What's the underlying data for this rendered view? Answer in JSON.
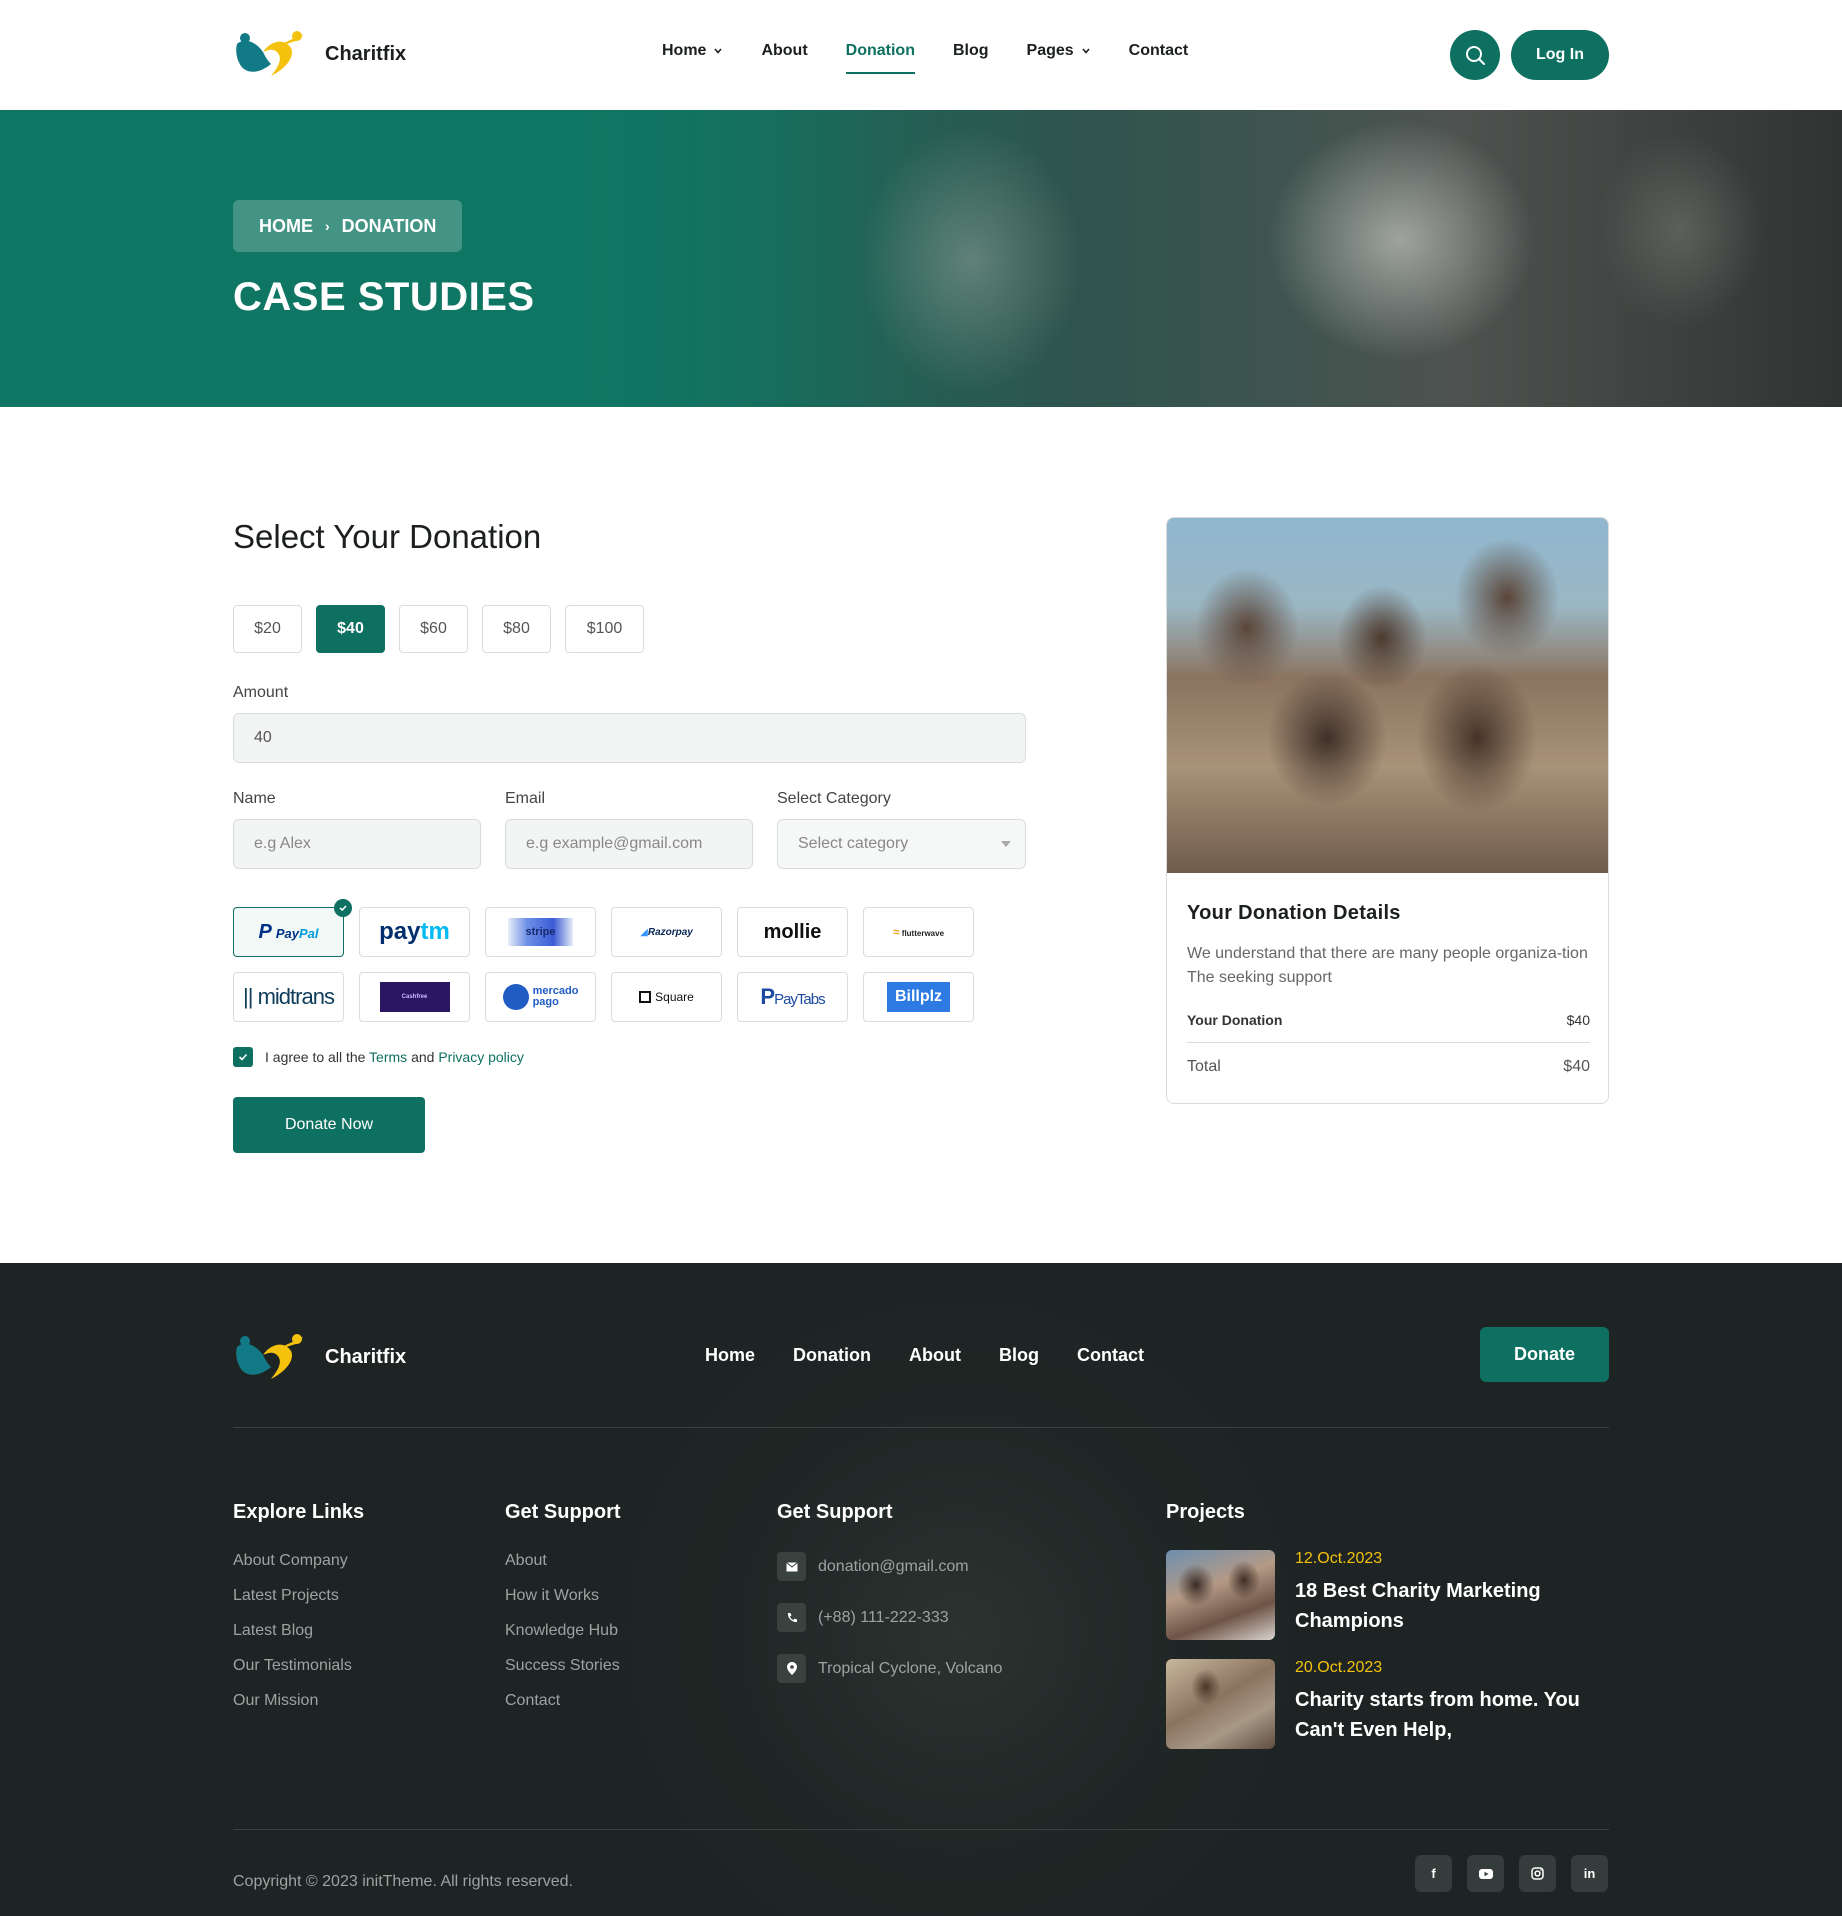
{
  "header": {
    "brand": "Charitfix",
    "nav": [
      {
        "label": "Home"
      },
      {
        "label": "About"
      },
      {
        "label": "Donation"
      },
      {
        "label": "Blog"
      },
      {
        "label": "Pages"
      },
      {
        "label": "Contact"
      }
    ],
    "login_label": "Log In",
    "search_icon": "search-icon"
  },
  "hero": {
    "breadcrumb": [
      "HOME",
      "DONATION"
    ],
    "title": "CASE STUDIES"
  },
  "donation": {
    "title": "Select Your Donation",
    "amounts": [
      "$20",
      "$40",
      "$60",
      "$80",
      "$100"
    ],
    "selected_amount": "$40",
    "amount_label": "Amount",
    "amount_value": "40",
    "name_label": "Name",
    "name_placeholder": "e.g Alex",
    "email_label": "Email",
    "email_placeholder": "e.g example@gmail.com",
    "category_label": "Select Category",
    "category_placeholder": "Select category",
    "payment_methods": [
      "PayPal",
      "Paytm",
      "stripe",
      "Razorpay",
      "mollie",
      "flutterwave",
      "midtrans",
      "Cashfree",
      "mercado pago",
      "Square",
      "PayTabs",
      "Billplz"
    ],
    "selected_payment": "PayPal",
    "agree_prefix": "I agree to all the",
    "terms": "Terms",
    "and": "and",
    "privacy": "Privacy policy",
    "donate_label": "Donate Now"
  },
  "details": {
    "title": "Your Donation Details",
    "description": "We understand that there are many people organiza-tion The seeking support",
    "your_donation_label": "Your Donation",
    "your_donation_value": "$40",
    "total_label": "Total",
    "total_value": "$40"
  },
  "footer": {
    "brand": "Charitfix",
    "nav": [
      "Home",
      "Donation",
      "About",
      "Blog",
      "Contact"
    ],
    "donate_label": "Donate",
    "explore_title": "Explore Links",
    "explore_links": [
      "About Company",
      "Latest Projects",
      "Latest Blog",
      "Our Testimonials",
      "Our Mission"
    ],
    "support_title": "Get Support",
    "support_links": [
      "About",
      "How it Works",
      "Knowledge Hub",
      "Success Stories",
      "Contact"
    ],
    "contact_title": "Get Support",
    "email": "donation@gmail.com",
    "phone": "(+88) 111-222-333",
    "address": "Tropical Cyclone, Volcano",
    "projects_title": "Projects",
    "projects": [
      {
        "date": "12.Oct.2023",
        "title": "18 Best Charity Marketing Champions"
      },
      {
        "date": "20.Oct.2023",
        "title": "Charity starts from home. You Can't Even Help,"
      }
    ],
    "copyright": "Copyright © 2023 initTheme. All rights reserved.",
    "socials": [
      "facebook-icon",
      "youtube-icon",
      "instagram-icon",
      "linkedin-icon"
    ]
  },
  "colors": {
    "primary": "#0d7060",
    "accent": "#f4c20d",
    "footer_bg": "#1f2625"
  }
}
